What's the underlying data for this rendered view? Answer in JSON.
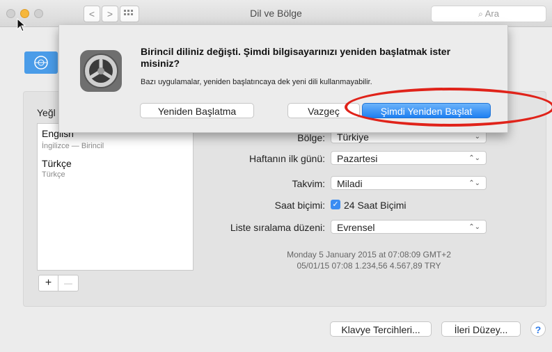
{
  "window": {
    "title": "Dil ve Bölge",
    "search_placeholder": "Ara",
    "back_label": "<",
    "forward_label": ">"
  },
  "languages": {
    "header": "Yeğl",
    "items": [
      {
        "name": "English",
        "sub": "İngilizce — Birincil"
      },
      {
        "name": "Türkçe",
        "sub": "Türkçe"
      }
    ],
    "add_label": "+",
    "remove_label": "—"
  },
  "settings": {
    "region": {
      "label": "Bölge:",
      "value": "Türkiye"
    },
    "first_day": {
      "label": "Haftanın ilk günü:",
      "value": "Pazartesi"
    },
    "calendar": {
      "label": "Takvim:",
      "value": "Miladi"
    },
    "time_format": {
      "label": "Saat biçimi:",
      "value": "24 Saat Biçimi",
      "checked": true
    },
    "sort_order": {
      "label": "Liste sıralama düzeni:",
      "value": "Evrensel"
    }
  },
  "sample": {
    "line1": "Monday 5 January 2015 at 07:08:09 GMT+2",
    "line2": "05/01/15 07:08    1.234,56    4.567,89 TRY"
  },
  "bottom_buttons": {
    "keyboard": "Klavye Tercihleri...",
    "advanced": "İleri Düzey...",
    "help": "?"
  },
  "sheet": {
    "title": "Birincil diliniz değişti. Şimdi bilgisayarınızı yeniden başlatmak ister misiniz?",
    "message": "Bazı uygulamalar, yeniden başlatıncaya dek yeni dili kullanmayabilir.",
    "no_restart": "Yeniden Başlatma",
    "cancel": "Vazgeç",
    "restart_now": "Şimdi Yeniden Başlat"
  },
  "colors": {
    "accent": "#1e7ff1",
    "annotation": "#e0231a"
  }
}
